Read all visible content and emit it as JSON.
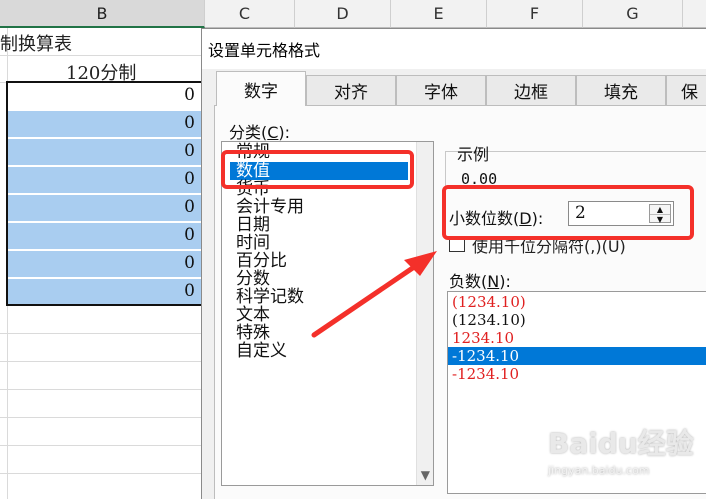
{
  "sheet": {
    "columns": [
      {
        "letter": "B"
      },
      {
        "letter": "C"
      },
      {
        "letter": "D"
      },
      {
        "letter": "E"
      },
      {
        "letter": "F"
      },
      {
        "letter": "G"
      }
    ],
    "title_text": "制换算表",
    "subtitle_text": "120分制",
    "cell_values": [
      "0",
      "0",
      "0",
      "0",
      "0",
      "0",
      "0",
      "0"
    ]
  },
  "dialog": {
    "title": "设置单元格格式",
    "tabs": [
      "数字",
      "对齐",
      "字体",
      "边框",
      "填充",
      "保"
    ],
    "active_tab": "数字",
    "category_label": "分类(",
    "category_label_key": "C",
    "category_label_end": "):",
    "categories": [
      "常规",
      "数值",
      "货币",
      "会计专用",
      "日期",
      "时间",
      "百分比",
      "分数",
      "科学记数",
      "文本",
      "特殊",
      "自定义"
    ],
    "selected_category": "数值",
    "sample_label": "示例",
    "sample_value": "0.00",
    "decimal_label": "小数位数(",
    "decimal_label_key": "D",
    "decimal_label_end": "):",
    "decimal_value": "2",
    "thousands_label": "使用千位分隔符(,)(U)",
    "negative_label": "负数(",
    "negative_label_key": "N",
    "negative_label_end": "):",
    "negative_formats": [
      {
        "text": "(1234.10)",
        "color": "#e02020"
      },
      {
        "text": "(1234.10)",
        "color": "#111111"
      },
      {
        "text": "1234.10",
        "color": "#e02020"
      },
      {
        "text": "-1234.10",
        "color": "#ffffff",
        "selected": true
      },
      {
        "text": "-1234.10",
        "color": "#e02020"
      }
    ]
  },
  "watermark": {
    "brand": "Baidu经验",
    "sub": "jingyan.baidu.com"
  },
  "colors": {
    "highlight": "#f4302a",
    "selection_blue": "#0078d7",
    "cell_blue": "#a9cdf0"
  }
}
